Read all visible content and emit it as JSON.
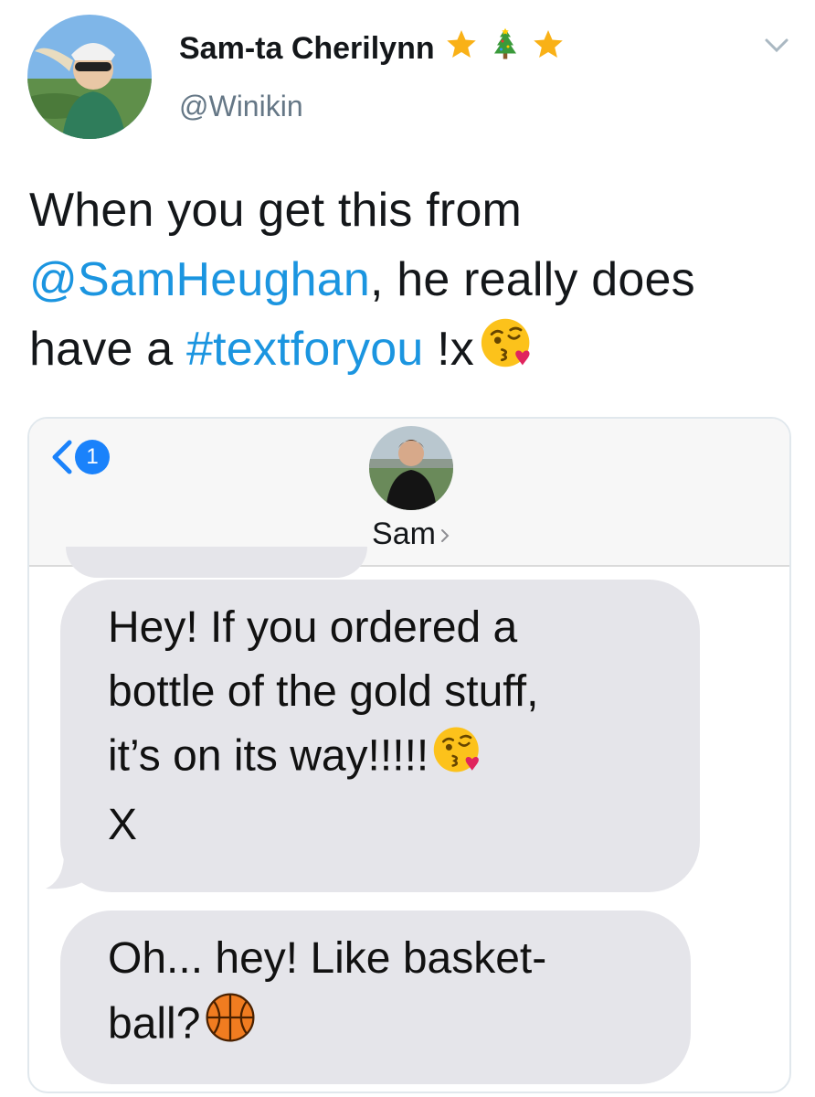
{
  "author": {
    "display_name": "Sam-ta Cherilynn",
    "handle": "@Winikin",
    "name_emojis": [
      "star-icon",
      "christmas-tree-icon",
      "star-icon"
    ]
  },
  "tweet": {
    "text_1": "When you get this from ",
    "mention": "@SamHeughan",
    "text_2": ", he really does have a ",
    "hashtag": "#textforyou",
    "text_3": " !x",
    "emoji": "face-blowing-kiss-icon"
  },
  "messages_screenshot": {
    "back_badge": "1",
    "contact_name": "Sam",
    "bubbles": [
      {
        "line_1": "Hey! If you ordered a",
        "line_2": "bottle of the gold stuff,",
        "line_3": "it’s on its way!!!!!",
        "line_4": "X",
        "emoji": "face-blowing-kiss-icon"
      },
      {
        "line_1": "Oh... hey! Like basket-",
        "line_2": "ball?",
        "emoji": "basketball-icon"
      }
    ]
  },
  "colors": {
    "link": "#1b95e0",
    "bubble": "#e5e5ea",
    "ios_blue": "#1a82fb",
    "handle": "#657786"
  }
}
